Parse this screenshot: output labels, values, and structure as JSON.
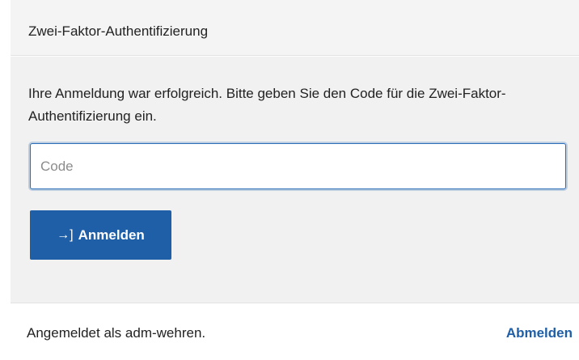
{
  "header": {
    "title": "Zwei-Faktor-Authentifizierung"
  },
  "body": {
    "message": "Ihre Anmeldung war erfolgreich. Bitte geben Sie den Code für die Zwei-Faktor-Authentifizierung ein.",
    "code_input": {
      "placeholder": "Code",
      "value": ""
    },
    "login_button": {
      "icon": "sign-in-icon",
      "icon_glyph": "→]",
      "label": "Anmelden"
    }
  },
  "footer": {
    "status_text": "Angemeldet als adm-wehren.",
    "logout_label": "Abmelden"
  },
  "colors": {
    "accent": "#1f5fa8",
    "panel_background": "#f1f1f1"
  }
}
